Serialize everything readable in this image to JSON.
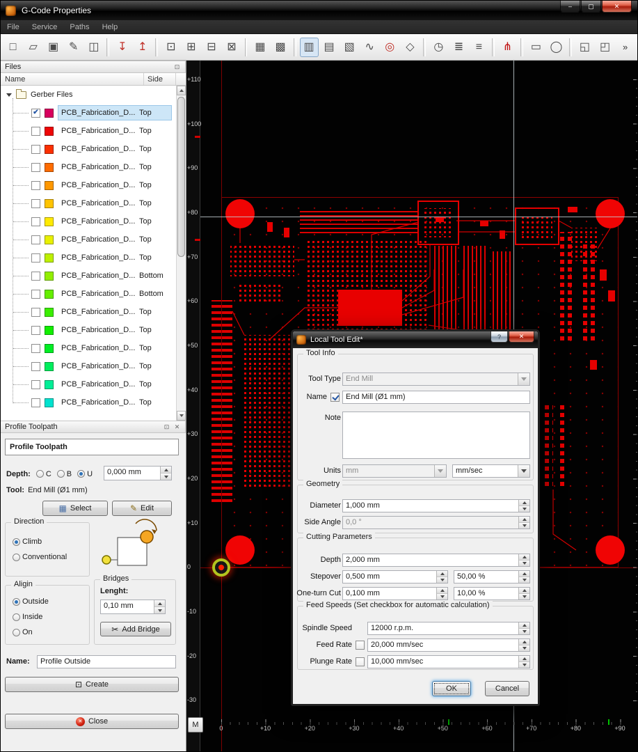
{
  "window": {
    "title": "G-Code Properties",
    "controls": {
      "minimize": "–",
      "maximize": "▢",
      "close": "✕"
    }
  },
  "menu": {
    "items": [
      "File",
      "Service",
      "Paths",
      "Help"
    ]
  },
  "toolbar": {
    "items": [
      {
        "name": "new-file-button",
        "glyph": "□"
      },
      {
        "name": "open-file-button",
        "glyph": "▱"
      },
      {
        "name": "save-button",
        "glyph": "▣"
      },
      {
        "name": "save-as-button",
        "glyph": "✎"
      },
      {
        "name": "save-all-button",
        "glyph": "◫"
      },
      {
        "name": "toolbar-separator",
        "kind": "sep"
      },
      {
        "name": "import-top-layer-button",
        "glyph": "↧",
        "tint": "#c03028"
      },
      {
        "name": "import-bottom-layer-button",
        "glyph": "↥",
        "tint": "#c03028"
      },
      {
        "name": "toolbar-separator",
        "kind": "sep"
      },
      {
        "name": "origin-tool-button",
        "glyph": "⊡"
      },
      {
        "name": "frame-tool-button",
        "glyph": "⊞"
      },
      {
        "name": "measure-tool-button",
        "glyph": "⊟"
      },
      {
        "name": "erase-tool-button",
        "glyph": "⊠"
      },
      {
        "name": "toolbar-separator",
        "kind": "sep"
      },
      {
        "name": "panelize-button",
        "glyph": "▦"
      },
      {
        "name": "array-copy-button",
        "glyph": "▩"
      },
      {
        "name": "toolbar-separator",
        "kind": "sep"
      },
      {
        "name": "view-copper-button",
        "glyph": "▥",
        "kind": "pressed"
      },
      {
        "name": "view-outline-button",
        "glyph": "▤"
      },
      {
        "name": "view-solder-button",
        "glyph": "▧"
      },
      {
        "name": "curve-tool-button",
        "glyph": "∿"
      },
      {
        "name": "drill-view-button",
        "glyph": "◎",
        "tint": "#c03028"
      },
      {
        "name": "selection-frame-button",
        "glyph": "◇"
      },
      {
        "name": "toolbar-separator",
        "kind": "sep"
      },
      {
        "name": "time-estimate-button",
        "glyph": "◷"
      },
      {
        "name": "gcode-view-button",
        "glyph": "≣"
      },
      {
        "name": "layers-list-button",
        "glyph": "≡"
      },
      {
        "name": "toolbar-separator",
        "kind": "sep"
      },
      {
        "name": "junction-tool-button",
        "glyph": "⋔",
        "tint": "#c01010"
      },
      {
        "name": "toolbar-separator",
        "kind": "sep"
      },
      {
        "name": "rect-shape-button",
        "glyph": "▭"
      },
      {
        "name": "ellipse-shape-button",
        "glyph": "◯"
      },
      {
        "name": "toolbar-separator",
        "kind": "sep"
      },
      {
        "name": "node-edit-button",
        "glyph": "◱"
      },
      {
        "name": "node-add-button",
        "glyph": "◰"
      },
      {
        "name": "toolbar-overflow",
        "glyph": "»"
      }
    ]
  },
  "files_panel": {
    "title": "Files",
    "float_icon": "⊡",
    "columns": {
      "name": "Name",
      "side": "Side"
    },
    "root_label": "Gerber Files",
    "rows": [
      {
        "label": "PCB_Fabrication_D...",
        "side": "Top",
        "color": "#d8005e",
        "check": "✔",
        "state": "selected"
      },
      {
        "label": "PCB_Fabrication_D...",
        "side": "Top",
        "color": "#ee0606",
        "check": ""
      },
      {
        "label": "PCB_Fabrication_D...",
        "side": "Top",
        "color": "#fb3000",
        "check": ""
      },
      {
        "label": "PCB_Fabrication_D...",
        "side": "Top",
        "color": "#ff6c00",
        "check": ""
      },
      {
        "label": "PCB_Fabrication_D...",
        "side": "Top",
        "color": "#ff9800",
        "check": ""
      },
      {
        "label": "PCB_Fabrication_D...",
        "side": "Top",
        "color": "#ffc400",
        "check": ""
      },
      {
        "label": "PCB_Fabrication_D...",
        "side": "Top",
        "color": "#ffea00",
        "check": ""
      },
      {
        "label": "PCB_Fabrication_D...",
        "side": "Top",
        "color": "#e8f000",
        "check": ""
      },
      {
        "label": "PCB_Fabrication_D...",
        "side": "Top",
        "color": "#bef000",
        "check": ""
      },
      {
        "label": "PCB_Fabrication_D...",
        "side": "Bottom",
        "color": "#92ee00",
        "check": ""
      },
      {
        "label": "PCB_Fabrication_D...",
        "side": "Bottom",
        "color": "#65ee00",
        "check": ""
      },
      {
        "label": "PCB_Fabrication_D...",
        "side": "Top",
        "color": "#3bee00",
        "check": ""
      },
      {
        "label": "PCB_Fabrication_D...",
        "side": "Top",
        "color": "#12ee00",
        "check": ""
      },
      {
        "label": "PCB_Fabrication_D...",
        "side": "Top",
        "color": "#00ee24",
        "check": ""
      },
      {
        "label": "PCB_Fabrication_D...",
        "side": "Top",
        "color": "#00ee5d",
        "check": ""
      },
      {
        "label": "PCB_Fabrication_D...",
        "side": "Top",
        "color": "#00ee96",
        "check": ""
      },
      {
        "label": "PCB_Fabrication_D...",
        "side": "Top",
        "color": "#00e2cf",
        "check": ""
      }
    ]
  },
  "profile_panel": {
    "title": "Profile Toolpath",
    "float_icon": "⊡",
    "close_icon": "✕",
    "header_box": "Profile Toolpath",
    "depth_label": "Depth:",
    "depth_options": {
      "c": "C",
      "b": "B",
      "u": "U"
    },
    "depth_value": "0,000 mm",
    "tool_label": "Tool:",
    "tool_value": "End Mill (Ø1 mm)",
    "select_icon": "▦",
    "select_button": "Select",
    "edit_icon": "✎",
    "edit_button": "Edit",
    "direction_group": "Direction",
    "direction_climb": "Climb",
    "direction_conventional": "Conventional",
    "align_group": "Aligin",
    "align_outside": "Outside",
    "align_inside": "Inside",
    "align_on": "On",
    "bridges_group": "Bridges",
    "length_label": "Lenght:",
    "length_value": "0,10 mm",
    "bridge_icon": "✂",
    "add_bridge_button": "Add Bridge",
    "name_label": "Name:",
    "name_value": "Profile Outside",
    "create_icon": "⊡",
    "create_button": "Create",
    "close_btn_icon": "✕",
    "close_button": "Close"
  },
  "canvas": {
    "v_labels": [
      "+110",
      "+100",
      "+90",
      "+80",
      "+70",
      "+60",
      "+50",
      "+40",
      "+30",
      "+20",
      "+10",
      "0",
      "-10",
      "-20",
      "-30"
    ],
    "h_labels": [
      "0",
      "+10",
      "+20",
      "+30",
      "+40",
      "+50",
      "+60",
      "+70",
      "+80",
      "+90"
    ],
    "m_button": "M"
  },
  "dialog": {
    "title": "Local Tool Edit*",
    "help_button": "?",
    "close_button": "✕",
    "tool_info": {
      "group": "Tool Info",
      "tool_type_label": "Tool Type",
      "tool_type_value": "End Mill",
      "name_label": "Name",
      "name_value": "End Mill (Ø1 mm)",
      "note_label": "Note",
      "note_value": "",
      "units_label": "Units",
      "units_value": "mm",
      "speed_units_value": "mm/sec"
    },
    "geometry": {
      "group": "Geometry",
      "diameter_label": "Diameter",
      "diameter_value": "1,000 mm",
      "side_angle_label": "Side Angle",
      "side_angle_value": "0,0 °"
    },
    "cutting": {
      "group": "Cutting Parameters",
      "depth_label": "Depth",
      "depth_value": "2,000 mm",
      "stepover_label": "Stepover",
      "stepover_value": "0,500 mm",
      "stepover_percent": "50,00 %",
      "oneturn_label": "One-turn Cut",
      "oneturn_value": "0,100 mm",
      "oneturn_percent": "10,00 %"
    },
    "feeds": {
      "group": "Feed Speeds (Set checkbox for automatic calculation)",
      "spindle_label": "Spindle Speed",
      "spindle_value": "12000 r.p.m.",
      "feed_label": "Feed Rate",
      "feed_value": "20,000 mm/sec",
      "plunge_label": "Plunge Rate",
      "plunge_value": "10,000 mm/sec"
    },
    "ok_button": "OK",
    "cancel_button": "Cancel"
  }
}
